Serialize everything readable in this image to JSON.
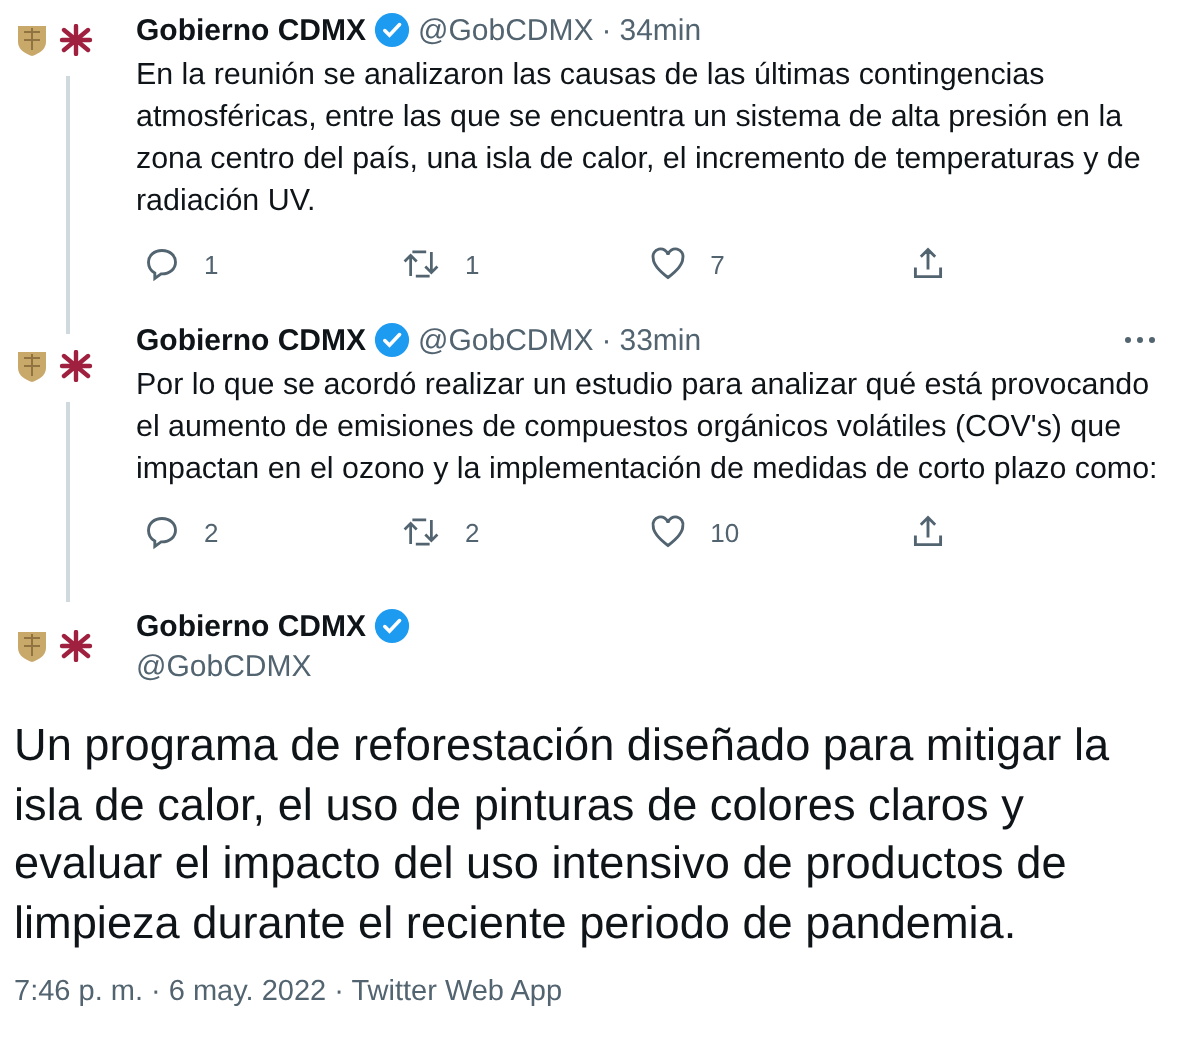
{
  "thread": [
    {
      "name": "Gobierno CDMX",
      "handle": "@GobCDMX",
      "sep": "·",
      "time": "34min",
      "text": "En la reunión se analizaron las causas de las últimas contingencias atmosféricas, entre las que se encuentra un sistema de alta presión en la zona centro del país, una isla de calor, el incremento de temperaturas y de radiación UV.",
      "replies": "1",
      "retweets": "1",
      "likes": "7",
      "menu": false
    },
    {
      "name": "Gobierno CDMX",
      "handle": "@GobCDMX",
      "sep": "·",
      "time": "33min",
      "text": "Por lo que se acordó realizar un estudio para analizar qué está provocando el aumento de emisiones de compuestos orgánicos volátiles (COV's) que impactan en el ozono y la implementación de medidas de corto plazo como:",
      "replies": "2",
      "retweets": "2",
      "likes": "10",
      "menu": true
    }
  ],
  "main": {
    "name": "Gobierno CDMX",
    "handle": "@GobCDMX",
    "text": "Un programa de reforestación diseñado para mitigar la isla de calor, el uso de pinturas de colores claros y evaluar el impacto del uso intensivo de productos de limpieza durante el reciente periodo de pandemia.",
    "meta": "7:46 p. m. · 6 may. 2022 · Twitter Web App"
  }
}
